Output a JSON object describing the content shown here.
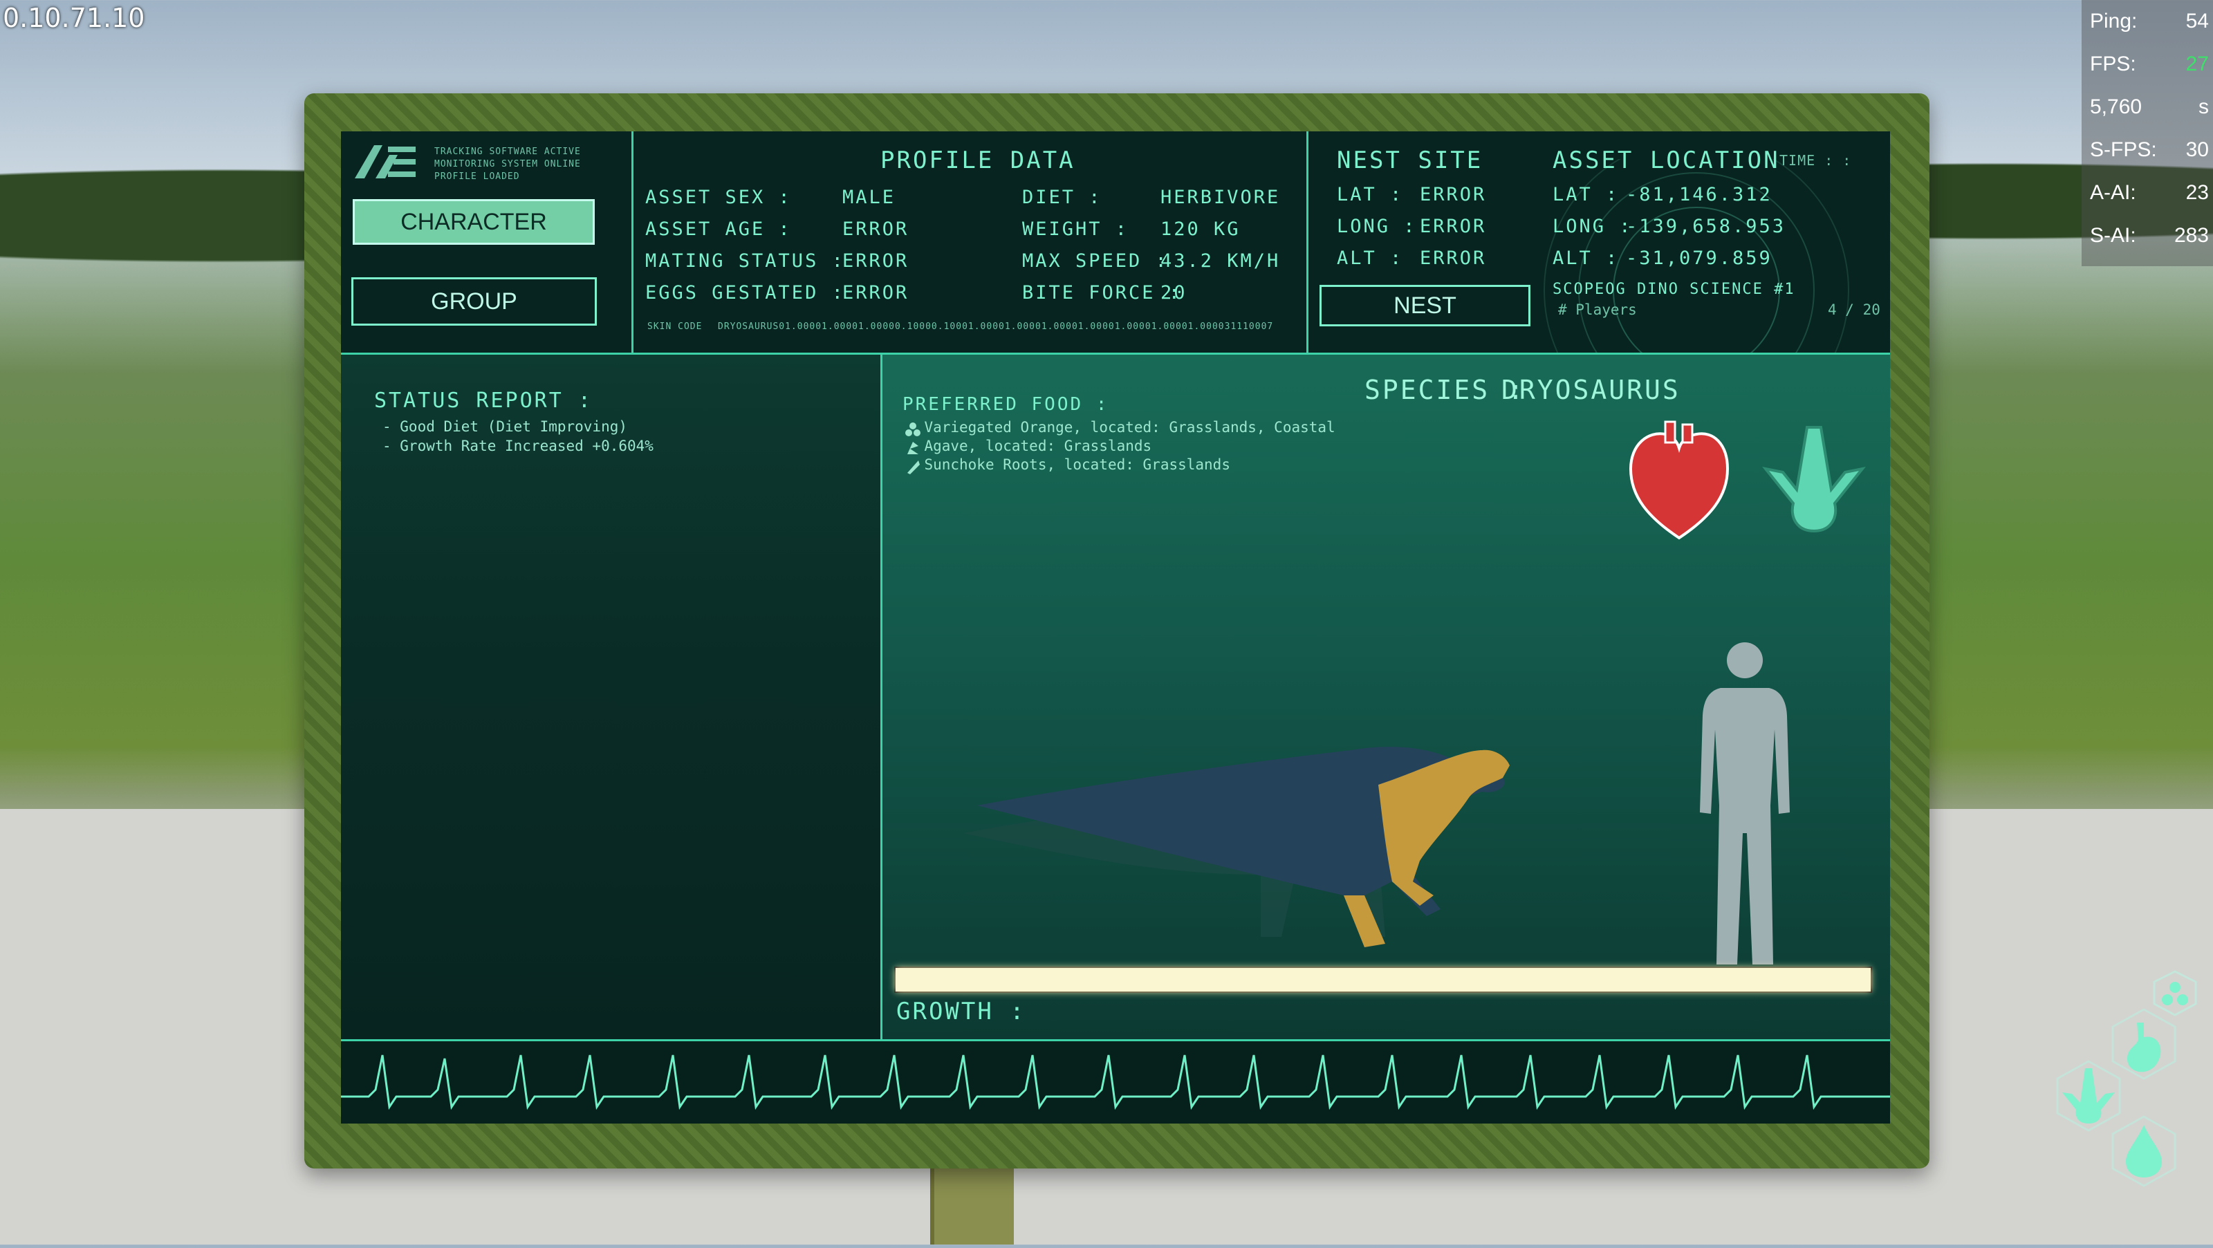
{
  "hud": {
    "version": "0.10.71.10",
    "stats": [
      {
        "label": "Ping:",
        "value": "54"
      },
      {
        "label": "FPS:",
        "value": "27"
      },
      {
        "label": "5,760",
        "value": "s"
      },
      {
        "label": "S-FPS:",
        "value": "30"
      },
      {
        "label": "A-AI:",
        "value": "23"
      },
      {
        "label": "S-AI:",
        "value": "283"
      }
    ]
  },
  "header": {
    "logo_text": "AE",
    "status_lines": [
      "TRACKING SOFTWARE ACTIVE",
      "MONITORING SYSTEM ONLINE",
      "PROFILE LOADED"
    ],
    "buttons": {
      "character": "CHARACTER",
      "group": "GROUP"
    }
  },
  "profile": {
    "title": "PROFILE DATA",
    "left": [
      {
        "label": "ASSET SEX :",
        "value": "MALE"
      },
      {
        "label": "ASSET AGE :",
        "value": "ERROR"
      },
      {
        "label": "MATING STATUS :",
        "value": "ERROR"
      },
      {
        "label": "EGGS GESTATED :",
        "value": "ERROR"
      }
    ],
    "right": [
      {
        "label": "DIET :",
        "value": "HERBIVORE"
      },
      {
        "label": "WEIGHT :",
        "value": "120 KG"
      },
      {
        "label": "MAX SPEED :",
        "value": "43.2 KM/H"
      },
      {
        "label": "BITE FORCE :",
        "value": "20"
      }
    ],
    "skin_code_label": "SKIN CODE",
    "skin_code_value": "DRYOSAURUS01.00001.00001.00000.10000.10001.00001.00001.00001.00001.00001.00001.000031110007"
  },
  "nest": {
    "title": "NEST SITE",
    "rows": [
      {
        "label": "LAT :",
        "value": "ERROR"
      },
      {
        "label": "LONG :",
        "value": "ERROR"
      },
      {
        "label": "ALT :",
        "value": "ERROR"
      }
    ],
    "button": "NEST"
  },
  "asset_location": {
    "title": "ASSET LOCATION",
    "time_label": "TIME : :",
    "rows": [
      {
        "label": "LAT :",
        "value": "-81,146.312"
      },
      {
        "label": "LONG :",
        "value": "-139,658.953"
      },
      {
        "label": "ALT :",
        "value": "-31,079.859"
      }
    ],
    "server": "SCOPEOG DINO SCIENCE #1",
    "players_label": "# Players",
    "players_value": "4 / 20"
  },
  "status_report": {
    "title": "STATUS REPORT :",
    "items": [
      "- Good Diet (Diet Improving)",
      "- Growth Rate Increased +0.604%"
    ]
  },
  "food": {
    "title": "PREFERRED FOOD :",
    "items": [
      {
        "icon": "berries-icon",
        "text": "Variegated Orange, located: Grasslands, Coastal"
      },
      {
        "icon": "plant-icon",
        "text": "Agave, located: Grasslands"
      },
      {
        "icon": "root-icon",
        "text": "Sunchoke Roots, located: Grasslands"
      }
    ]
  },
  "species": {
    "label": "SPECIES :",
    "name": "DRYOSAURUS"
  },
  "growth": {
    "label": "GROWTH :",
    "progress": 1.0
  },
  "colors": {
    "accent": "#7ef1cd",
    "heart": "#d63535",
    "bar": "#fbf6d2"
  },
  "hex_menu": [
    "hex-dots-icon",
    "stomach-icon",
    "footprint-icon",
    "water-drop-icon"
  ]
}
